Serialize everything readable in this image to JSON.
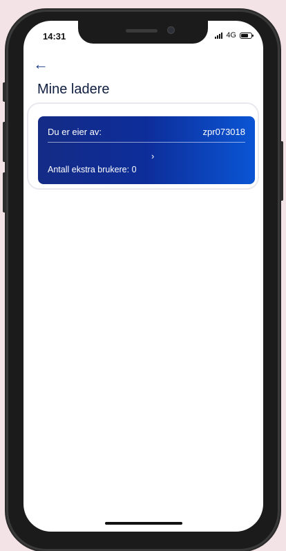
{
  "status_bar": {
    "time": "14:31",
    "network": "4G"
  },
  "header": {
    "back_icon": "arrow-left-icon",
    "title": "Mine ladere"
  },
  "charger_card": {
    "owner_label": "Du er eier av:",
    "owner_value": "zpr073018",
    "extra_users_label": "Antall ekstra brukere: ",
    "extra_users_count": "0",
    "chevron_icon": "chevron-right-icon",
    "gradient_start": "#142c86",
    "gradient_end": "#0a55d4"
  },
  "colors": {
    "background": "#f3e3e6",
    "accent": "#1d3a87"
  }
}
